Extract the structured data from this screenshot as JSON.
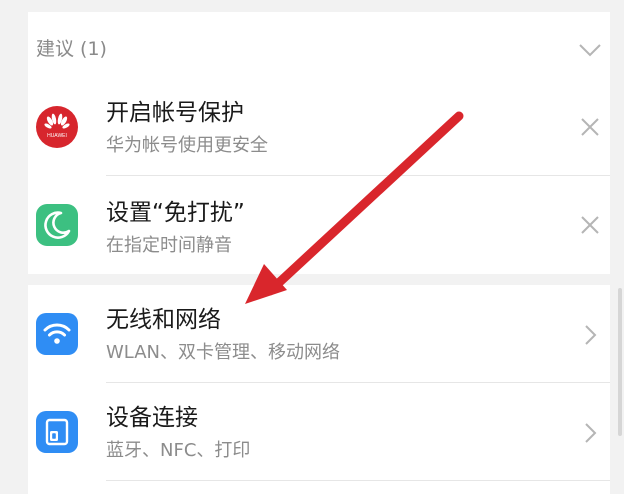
{
  "suggestions": {
    "header": "建议 (1)",
    "items": [
      {
        "title": "开启帐号保护",
        "subtitle": "华为帐号使用更安全",
        "icon": "huawei-logo-icon",
        "icon_text": "HUAWEI",
        "icon_color": "#d7262d",
        "action": "close-icon"
      },
      {
        "title": "设置“免打扰”",
        "subtitle": "在指定时间静音",
        "icon": "moon-icon",
        "icon_color": "#3cc081",
        "action": "close-icon"
      }
    ]
  },
  "settings": {
    "items": [
      {
        "title": "无线和网络",
        "subtitle": "WLAN、双卡管理、移动网络",
        "icon": "wifi-icon",
        "icon_color": "#2f8df4",
        "action": "chevron-right-icon"
      },
      {
        "title": "设备连接",
        "subtitle": "蓝牙、NFC、打印",
        "icon": "device-connection-icon",
        "icon_color": "#2f8df4",
        "action": "chevron-right-icon"
      }
    ]
  },
  "annotation": {
    "color": "#d9262c",
    "shape": "arrow-icon"
  }
}
